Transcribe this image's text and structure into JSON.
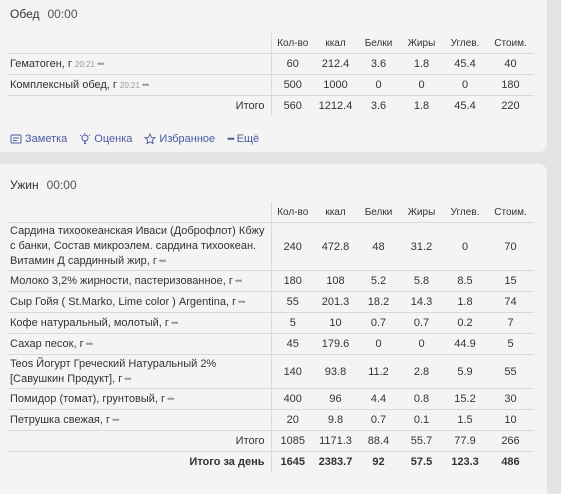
{
  "lunch": {
    "title": "Обед",
    "time": "00:00",
    "headers": [
      "Кол-во",
      "ккал",
      "Белки",
      "Жиры",
      "Углев.",
      "Стоим."
    ],
    "rows": [
      {
        "name": "Гематоген, г",
        "time": "20:21",
        "qty": "60",
        "kcal": "212.4",
        "prot": "3.6",
        "fat": "1.8",
        "carb": "45.4",
        "cost": "40"
      },
      {
        "name": "Комплексный обед, г",
        "time": "20:21",
        "qty": "500",
        "kcal": "1000",
        "prot": "0",
        "fat": "0",
        "carb": "0",
        "cost": "180"
      }
    ],
    "total": {
      "label": "Итого",
      "qty": "560",
      "kcal": "1212.4",
      "prot": "3.6",
      "fat": "1.8",
      "carb": "45.4",
      "cost": "220"
    },
    "actions": {
      "note": "Заметка",
      "rate": "Оценка",
      "favorite": "Избранное",
      "more": "Ещё"
    }
  },
  "dinner": {
    "title": "Ужин",
    "time": "00:00",
    "headers": [
      "Кол-во",
      "ккал",
      "Белки",
      "Жиры",
      "Углев.",
      "Стоим."
    ],
    "rows": [
      {
        "name": "Сардина тихоокеанская Иваси (Доброфлот) Кбжу с банки, Состав микроэлем. сардина тихоокеан. Витамин Д сардинный жир, г",
        "qty": "240",
        "kcal": "472.8",
        "prot": "48",
        "fat": "31.2",
        "carb": "0",
        "cost": "70"
      },
      {
        "name": "Молоко 3,2% жирности, пастеризованное, г",
        "qty": "180",
        "kcal": "108",
        "prot": "5.2",
        "fat": "5.8",
        "carb": "8.5",
        "cost": "15"
      },
      {
        "name": "Сыр Гойя ( St.Marko, Lime color ) Argentina, г",
        "qty": "55",
        "kcal": "201.3",
        "prot": "18.2",
        "fat": "14.3",
        "carb": "1.8",
        "cost": "74"
      },
      {
        "name": "Кофе натуральный, молотый, г",
        "qty": "5",
        "kcal": "10",
        "prot": "0.7",
        "fat": "0.7",
        "carb": "0.2",
        "cost": "7"
      },
      {
        "name": "Сахар песок, г",
        "qty": "45",
        "kcal": "179.6",
        "prot": "0",
        "fat": "0",
        "carb": "44.9",
        "cost": "5"
      },
      {
        "name": "Teos Йогурт Греческий Натуральный 2% [Савушкин Продукт], г",
        "qty": "140",
        "kcal": "93.8",
        "prot": "11.2",
        "fat": "2.8",
        "carb": "5.9",
        "cost": "55"
      },
      {
        "name": "Помидор (томат), грунтовый, г",
        "qty": "400",
        "kcal": "96",
        "prot": "4.4",
        "fat": "0.8",
        "carb": "15.2",
        "cost": "30"
      },
      {
        "name": "Петрушка свежая, г",
        "qty": "20",
        "kcal": "9.8",
        "prot": "0.7",
        "fat": "0.1",
        "carb": "1.5",
        "cost": "10"
      }
    ],
    "total": {
      "label": "Итого",
      "qty": "1085",
      "kcal": "1171.3",
      "prot": "88.4",
      "fat": "55.7",
      "carb": "77.9",
      "cost": "266"
    },
    "day_total": {
      "label": "Итого за день",
      "qty": "1645",
      "kcal": "2383.7",
      "prot": "92",
      "fat": "57.5",
      "carb": "123.3",
      "cost": "486"
    }
  },
  "icons": {
    "note": "note-icon",
    "rate": "lightbulb-icon",
    "favorite": "star-icon",
    "more": "more-dots-icon",
    "row_menu": "row-menu-dots-icon"
  },
  "colors": {
    "link": "#4a5ba0",
    "border": "#d9d9d9",
    "card": "#f4f4f4",
    "background": "#e4e4e4"
  }
}
